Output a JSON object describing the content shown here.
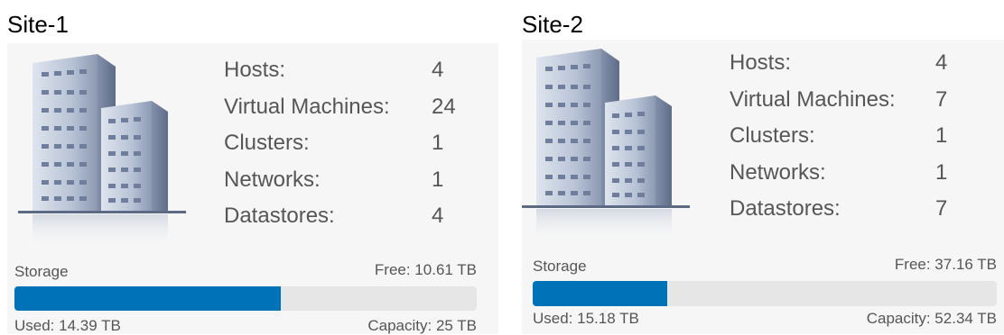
{
  "sites": [
    {
      "title": "Site-1",
      "stats": [
        {
          "label": "Hosts:",
          "value": "4"
        },
        {
          "label": "Virtual Machines:",
          "value": "24"
        },
        {
          "label": "Clusters:",
          "value": "1"
        },
        {
          "label": "Networks:",
          "value": "1"
        },
        {
          "label": "Datastores:",
          "value": "4"
        }
      ],
      "storage": {
        "label": "Storage",
        "free": "Free: 10.61 TB",
        "used": "Used: 14.39 TB",
        "capacity": "Capacity: 25 TB",
        "used_fraction": 0.5756
      }
    },
    {
      "title": "Site-2",
      "stats": [
        {
          "label": "Hosts:",
          "value": "4"
        },
        {
          "label": "Virtual Machines:",
          "value": "7"
        },
        {
          "label": "Clusters:",
          "value": "1"
        },
        {
          "label": "Networks:",
          "value": "1"
        },
        {
          "label": "Datastores:",
          "value": "7"
        }
      ],
      "storage": {
        "label": "Storage",
        "free": "Free: 37.16 TB",
        "used": "Used: 15.18 TB",
        "capacity": "Capacity: 52.34 TB",
        "used_fraction": 0.29
      }
    }
  ],
  "colors": {
    "bar_fill": "#0072b8",
    "bar_track": "#e6e6e6",
    "panel_bg": "#f6f6f6",
    "text_muted": "#565656"
  },
  "icons": {
    "building": "building-icon"
  }
}
